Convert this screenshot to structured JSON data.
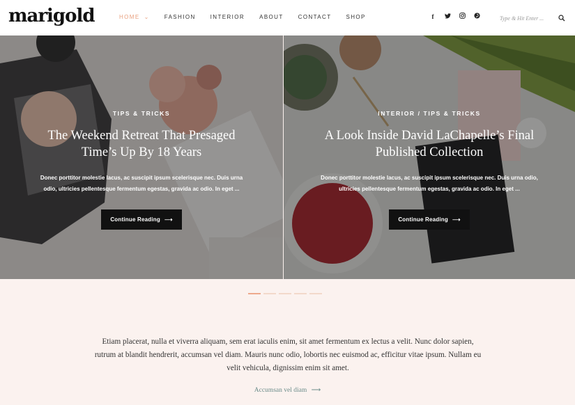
{
  "header": {
    "logo": "marigold",
    "nav": [
      {
        "label": "HOME",
        "active": true,
        "has_dropdown": true
      },
      {
        "label": "FASHION"
      },
      {
        "label": "INTERIOR"
      },
      {
        "label": "ABOUT"
      },
      {
        "label": "CONTACT"
      },
      {
        "label": "SHOP"
      }
    ],
    "social": {
      "facebook": "f",
      "twitter": "t",
      "instagram": "◎",
      "pinterest": "⊙"
    },
    "search": {
      "placeholder": "Type & Hit Enter ...",
      "icon": "search-icon"
    }
  },
  "slides": [
    {
      "category": "TIPS & TRICKS",
      "title": "The Weekend Retreat That Presaged Time’s Up By 18 Years",
      "excerpt": "Donec porttitor molestie lacus, ac suscipit ipsum scelerisque nec. Duis urna odio, ultricies pellentesque fermentum egestas, gravida ac odio. In eget ...",
      "button": "Continue Reading"
    },
    {
      "category": "INTERIOR / TIPS & TRICKS",
      "title": "A Look Inside David LaChapelle’s Final Published Collection",
      "excerpt": "Donec porttitor molestie lacus, ac suscipit ipsum scelerisque nec. Duis urna odio, ultricies pellentesque fermentum egestas, gravida ac odio. In eget ...",
      "button": "Continue Reading"
    }
  ],
  "carousel": {
    "count": 5,
    "active": 0
  },
  "intro": {
    "text": "Etiam placerat, nulla et viverra aliquam, sem erat iaculis enim, sit amet fermentum ex lectus a velit. Nunc dolor sapien, rutrum at blandit hendrerit, accumsan vel diam. Mauris nunc odio, lobortis nec euismod ac, efficitur vitae ipsum. Nullam eu velit vehicula, dignissim enim sit amet.",
    "link": "Accumsan vel diam"
  },
  "colors": {
    "accent": "#e9a07f",
    "background": "#fbf2ef",
    "link": "#6b8c8a"
  }
}
